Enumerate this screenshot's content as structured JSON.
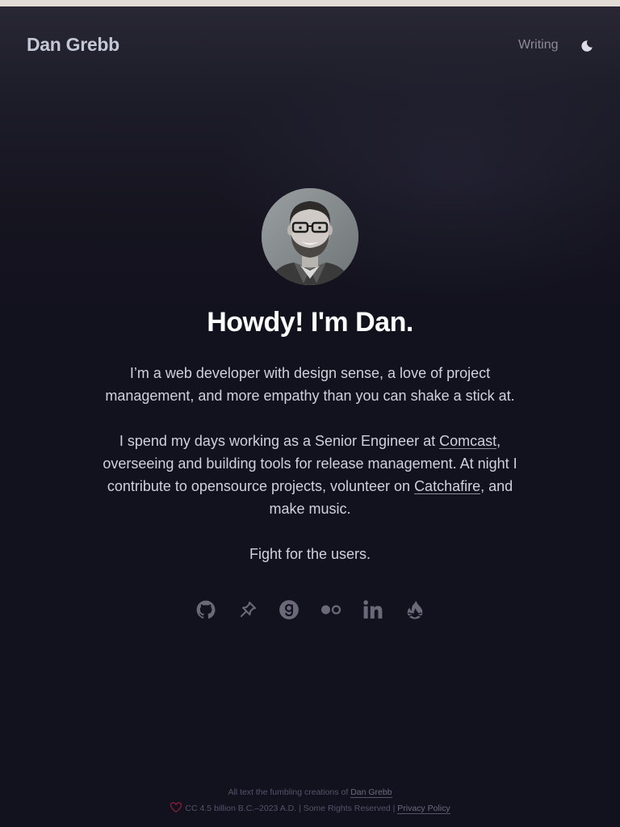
{
  "header": {
    "site_title": "Dan Grebb",
    "nav": {
      "writing_label": "Writing"
    },
    "theme_toggle_icon": "moon-icon"
  },
  "hero": {
    "avatar_icon": "profile-photo",
    "headline": "Howdy! I'm Dan.",
    "bio": {
      "p1": "I’m a web developer with design sense, a love of project management, and more empathy than you can shake a stick at.",
      "p2_before": "I spend my days working as a Senior Engineer at ",
      "p2_link1": "Comcast",
      "p2_middle": ", overseeing and building tools for release management. At night I contribute to opensource projects, volunteer on ",
      "p2_link2": "Catchafire",
      "p2_after": ", and make music.",
      "p3": "Fight for the users."
    }
  },
  "socials": [
    {
      "name": "github",
      "icon": "github-icon"
    },
    {
      "name": "pinboard",
      "icon": "pin-icon"
    },
    {
      "name": "goodreads",
      "icon": "goodreads-icon"
    },
    {
      "name": "flickr",
      "icon": "flickr-icon"
    },
    {
      "name": "linkedin",
      "icon": "linkedin-icon"
    },
    {
      "name": "campfire",
      "icon": "flame-icon"
    }
  ],
  "footer": {
    "line1_text": "All text the fumbling creations of ",
    "line1_link": "Dan Grebb",
    "line2_text": "CC 4.5 billion B.C.–2023 A.D. | Some Rights Reserved | ",
    "line2_link": "Privacy Policy",
    "heart_icon": "heart-icon"
  },
  "colors": {
    "background": "#12111e",
    "top_strip": "#e3dcd6",
    "site_title": "#c3c8d6",
    "headline": "#ffffff",
    "body_text": "#d2d0da",
    "icon": "#6b6978",
    "heart": "#7a1f33"
  }
}
